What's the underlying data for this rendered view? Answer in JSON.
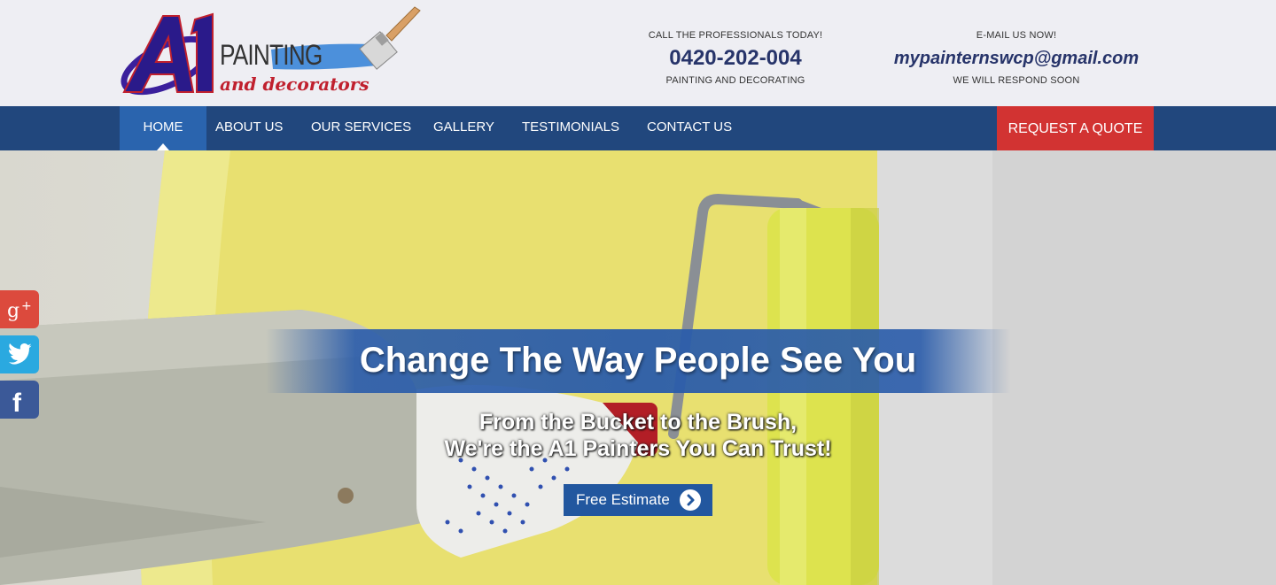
{
  "brand": {
    "logo_letters": "A1",
    "line1": "PAINTING",
    "line2": "and decorators",
    "colors": {
      "navy": "#21477d",
      "red": "#d23332",
      "purple": "#3a1f9c"
    }
  },
  "contact": {
    "phone": {
      "label": "CALL THE PROFESSIONALS TODAY!",
      "number": "0420-202-004",
      "sub": "PAINTING AND DECORATING"
    },
    "email": {
      "label": "E-MAIL US NOW!",
      "address": "mypainternswcp@gmail.com",
      "sub": "WE WILL RESPOND SOON"
    }
  },
  "nav": {
    "items": [
      {
        "label": "HOME",
        "active": true
      },
      {
        "label": "ABOUT US"
      },
      {
        "label": "OUR SERVICES"
      },
      {
        "label": "GALLERY"
      },
      {
        "label": "TESTIMONIALS"
      },
      {
        "label": "CONTACT US"
      }
    ],
    "quote_label": "REQUEST A QUOTE"
  },
  "hero": {
    "headline": "Change The Way People See You",
    "subline1": "From the Bucket to the Brush,",
    "subline2": "We're the A1  Painters You Can Trust!",
    "button_label": "Free Estimate",
    "button_icon": "chevron-right-circle-icon"
  },
  "social": [
    {
      "name": "google-plus-icon",
      "color": "#dc4a3d"
    },
    {
      "name": "twitter-icon",
      "color": "#2aa9e0"
    },
    {
      "name": "facebook-icon",
      "color": "#3b5998"
    }
  ]
}
